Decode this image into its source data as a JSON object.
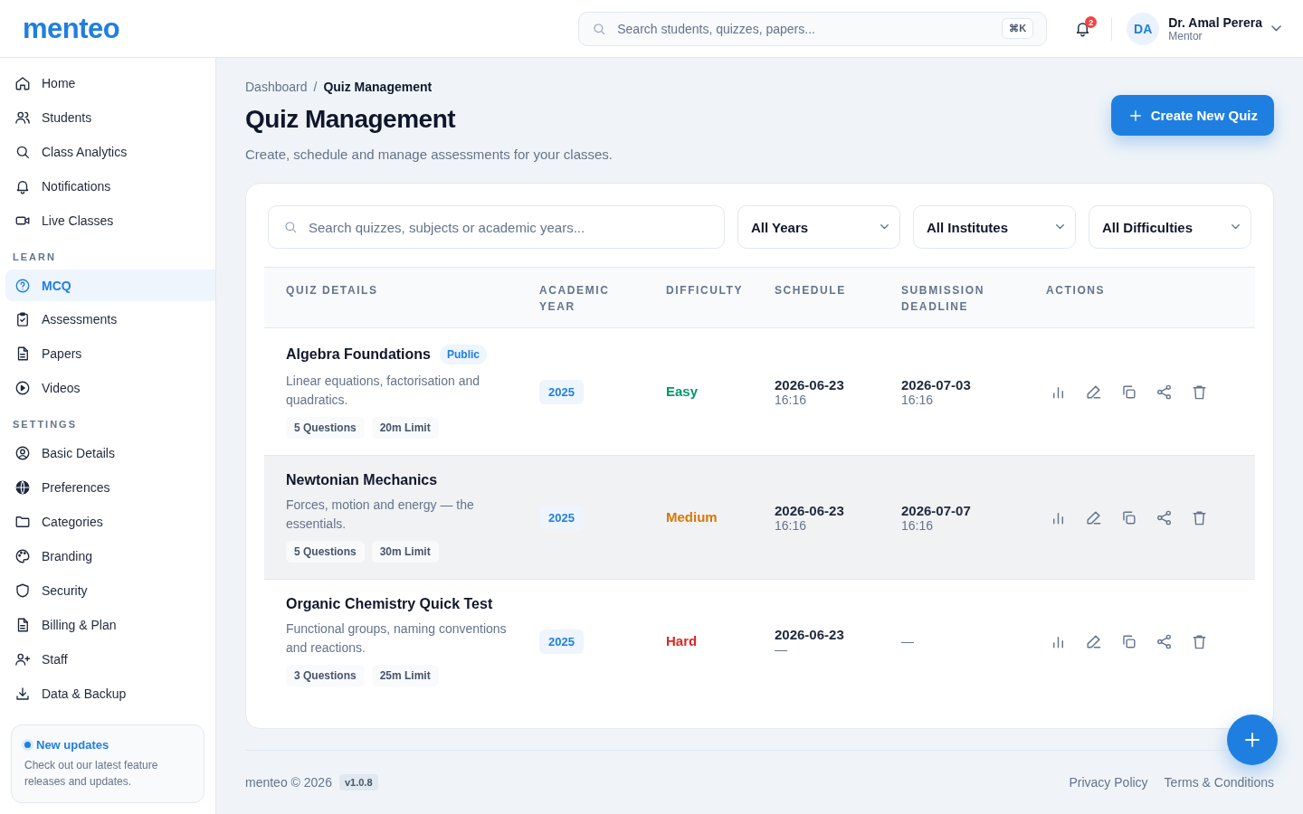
{
  "header": {
    "logo": "menteo",
    "search": {
      "placeholder": "Search students, quizzes, papers...",
      "shortcut": "⌘K"
    },
    "notifications": {
      "count": "2"
    },
    "user": {
      "initials": "DA",
      "name": "Dr. Amal Perera",
      "role": "Mentor"
    }
  },
  "sidebar": {
    "sections": [
      {
        "items": [
          {
            "label": "Home",
            "selected": false
          },
          {
            "label": "Students",
            "selected": false
          },
          {
            "label": "Class Analytics",
            "selected": false
          },
          {
            "label": "Notifications",
            "selected": false
          },
          {
            "label": "Live Classes",
            "selected": false
          }
        ]
      },
      {
        "title": "LEARN",
        "items": [
          {
            "label": "MCQ",
            "selected": true
          },
          {
            "label": "Assessments",
            "selected": false
          },
          {
            "label": "Papers",
            "selected": false
          },
          {
            "label": "Videos",
            "selected": false
          }
        ]
      },
      {
        "title": "SETTINGS",
        "items": [
          {
            "label": "Basic Details",
            "selected": false
          },
          {
            "label": "Preferences",
            "selected": false
          },
          {
            "label": "Categories",
            "selected": false
          },
          {
            "label": "Branding",
            "selected": false
          },
          {
            "label": "Security",
            "selected": false
          },
          {
            "label": "Billing & Plan",
            "selected": false
          },
          {
            "label": "Staff",
            "selected": false
          },
          {
            "label": "Data & Backup",
            "selected": false
          }
        ]
      }
    ],
    "update_card": {
      "title": "New updates",
      "text": "Check out our latest feature releases and updates."
    }
  },
  "breadcrumb": [
    "Dashboard",
    "Quiz Management"
  ],
  "breadcrumb_separator": "/",
  "page": {
    "title": "Quiz Management",
    "subtitle": "Create, schedule and manage assessments for your classes.",
    "create_button": "Create New Quiz"
  },
  "filters": {
    "search": {
      "placeholder": "Search quizzes, subjects or academic years..."
    },
    "dropdowns": [
      "All Years",
      "All Institutes",
      "All Difficulties"
    ]
  },
  "table": {
    "columns": [
      "QUIZ DETAILS",
      "ACADEMIC YEAR",
      "DIFFICULTY",
      "SCHEDULE",
      "SUBMISSION DEADLINE",
      "ACTIONS"
    ],
    "rows": [
      {
        "title": "Algebra Foundations",
        "badge": "Public",
        "description": "Linear equations, factorisation and quadratics.",
        "tags": [
          "5 Questions",
          "20m Limit"
        ],
        "year": "2025",
        "difficulty": {
          "label": "Easy",
          "color": "#059669"
        },
        "schedule": {
          "date": "2026-06-23",
          "time": "16:16"
        },
        "deadline": {
          "date": "2026-07-03",
          "time": "16:16"
        },
        "selected": false
      },
      {
        "title": "Newtonian Mechanics",
        "description": "Forces, motion and energy — the essentials.",
        "tags": [
          "5 Questions",
          "30m Limit"
        ],
        "year": "2025",
        "difficulty": {
          "label": "Medium",
          "color": "#d97706"
        },
        "schedule": {
          "date": "2026-06-23",
          "time": "16:16"
        },
        "deadline": {
          "date": "2026-07-07",
          "time": "16:16"
        },
        "selected": true
      },
      {
        "title": "Organic Chemistry Quick Test",
        "description": "Functional groups, naming conventions and reactions.",
        "tags": [
          "3 Questions",
          "25m Limit"
        ],
        "year": "2025",
        "difficulty": {
          "label": "Hard",
          "color": "#dc2626"
        },
        "schedule": {
          "date": "2026-06-23",
          "time": "—"
        },
        "deadline": {
          "date": "—"
        },
        "selected": false
      }
    ]
  },
  "footer": {
    "copyright": "menteo © 2026",
    "version": "v1.0.8",
    "links": [
      "Privacy Policy",
      "Terms & Conditions"
    ]
  }
}
